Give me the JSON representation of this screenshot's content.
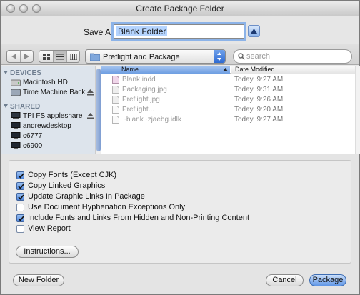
{
  "window": {
    "title": "Create Package Folder"
  },
  "save_as": {
    "label": "Save As:",
    "value": "Blank Folder"
  },
  "toolbar": {
    "location": "Preflight and Package",
    "search_placeholder": "search"
  },
  "sidebar": {
    "devices_header": "DEVICES",
    "shared_header": "SHARED",
    "devices": [
      {
        "label": "Macintosh HD",
        "icon": "hard-drive-icon",
        "eject": false
      },
      {
        "label": "Time Machine Back...",
        "icon": "external-drive-icon",
        "eject": true
      }
    ],
    "shared": [
      {
        "label": "TPI FS.appleshare",
        "icon": "network-server-icon",
        "eject": true
      },
      {
        "label": "andrewdesktop",
        "icon": "computer-icon",
        "eject": false
      },
      {
        "label": "c6777",
        "icon": "computer-icon",
        "eject": false
      },
      {
        "label": "c6900",
        "icon": "computer-icon",
        "eject": false
      }
    ]
  },
  "files": {
    "columns": {
      "name": "Name",
      "date": "Date Modified"
    },
    "rows": [
      {
        "name": "Blank.indd",
        "date": "Today, 9:27 AM",
        "icon": "indesign-file-icon"
      },
      {
        "name": "Packaging.jpg",
        "date": "Today, 9:31 AM",
        "icon": "image-file-icon"
      },
      {
        "name": "Preflight.jpg",
        "date": "Today, 9:26 AM",
        "icon": "image-file-icon"
      },
      {
        "name": "Preflight...",
        "date": "Today, 9:20 AM",
        "icon": "document-icon"
      },
      {
        "name": "~blank~zjaebg.idlk",
        "date": "Today, 9:27 AM",
        "icon": "document-icon"
      }
    ]
  },
  "options": {
    "checkboxes": [
      {
        "label": "Copy Fonts (Except CJK)",
        "checked": true
      },
      {
        "label": "Copy Linked Graphics",
        "checked": true
      },
      {
        "label": "Update Graphic Links In Package",
        "checked": true
      },
      {
        "label": "Use Document Hyphenation Exceptions Only",
        "checked": false
      },
      {
        "label": "Include Fonts and Links From Hidden and Non-Printing Content",
        "checked": true
      },
      {
        "label": "View Report",
        "checked": false
      }
    ],
    "instructions_button": "Instructions..."
  },
  "buttons": {
    "new_folder": "New Folder",
    "cancel": "Cancel",
    "package": "Package"
  },
  "colors": {
    "accent": "#5f96e6",
    "selection": "#b5d4fe"
  }
}
